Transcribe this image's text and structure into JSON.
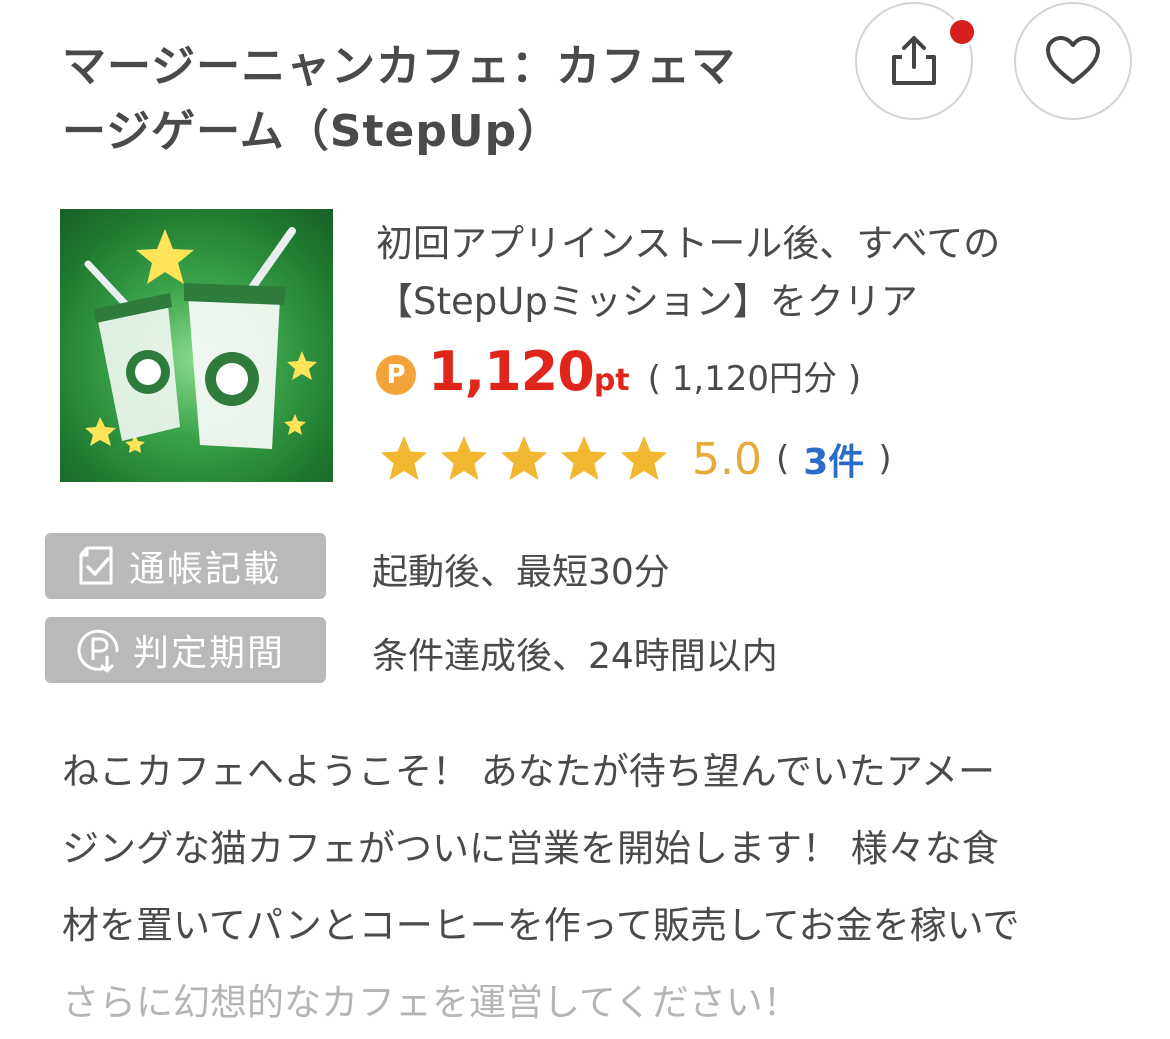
{
  "header": {
    "title_line1": "マージーニャンカフェ：カフェマ",
    "title_line2": "ージゲーム（StepUp）",
    "share_label": "シェア",
    "favorite_label": "お気に入り"
  },
  "offer": {
    "condition_line1": "初回アプリインストール後、すべての",
    "condition_line2": "【StepUpミッション】をクリア",
    "points_badge": "P",
    "points_value": "1,120",
    "points_unit": "pt",
    "yen_equivalent": "( 1,120円分 )",
    "rating": 5.0,
    "rating_text": "5.0",
    "rating_open": "(",
    "review_count": "3件",
    "rating_close": ")"
  },
  "details": {
    "bank_tag": "通帳記載",
    "bank_value": "起動後、最短30分",
    "judge_tag": "判定期間",
    "judge_value": "条件達成後、24時間以内"
  },
  "description": {
    "line1": "ねこカフェへようこそ！ あなたが待ち望んでいたアメー",
    "line2": "ジングな猫カフェがついに営業を開始します！ 様々な食",
    "line3": "材を置いてパンとコーヒーを作って販売してお金を稼いで",
    "line4": "さらに幻想的なカフェを運営してください！"
  },
  "icons": {
    "share": "share-icon",
    "favorite": "heart-icon",
    "star": "star-icon",
    "bank": "checkbook-icon",
    "judge": "points-timer-icon"
  },
  "colors": {
    "points_red": "#e0261c",
    "badge_orange": "#f2a33a",
    "star_gold": "#f2b731",
    "rating_gold": "#e7a93a",
    "link_blue": "#2b6cc4",
    "tag_gray": "#b9b9b9",
    "notification_red": "#d6201e"
  }
}
